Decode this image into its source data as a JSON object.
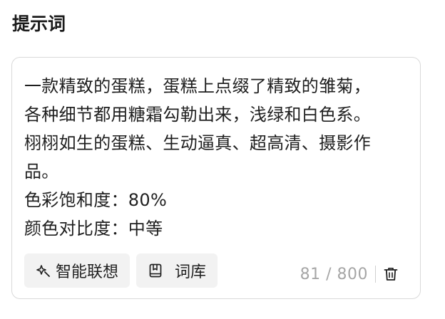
{
  "section": {
    "title": "提示词"
  },
  "prompt": {
    "text": "一款精致的蛋糕，蛋糕上点缀了精致的雏菊，各种细节都用糖霜勾勒出来，浅绿和白色系。栩栩如生的蛋糕、生动逼真、超高清、摄影作品。\n色彩饱和度：80%\n颜色对比度：中等"
  },
  "toolbar": {
    "smart_assoc_label": "智能联想",
    "smart_assoc_icon": "sparkle-icon",
    "lexicon_label": "词库",
    "lexicon_icon": "book-icon"
  },
  "counter": {
    "text": "81 / 800"
  },
  "actions": {
    "delete_icon": "trash-icon"
  },
  "colors": {
    "border": "#d9d9d9",
    "button_bg": "#f2f2f2",
    "counter_text": "#a6a6a6"
  }
}
